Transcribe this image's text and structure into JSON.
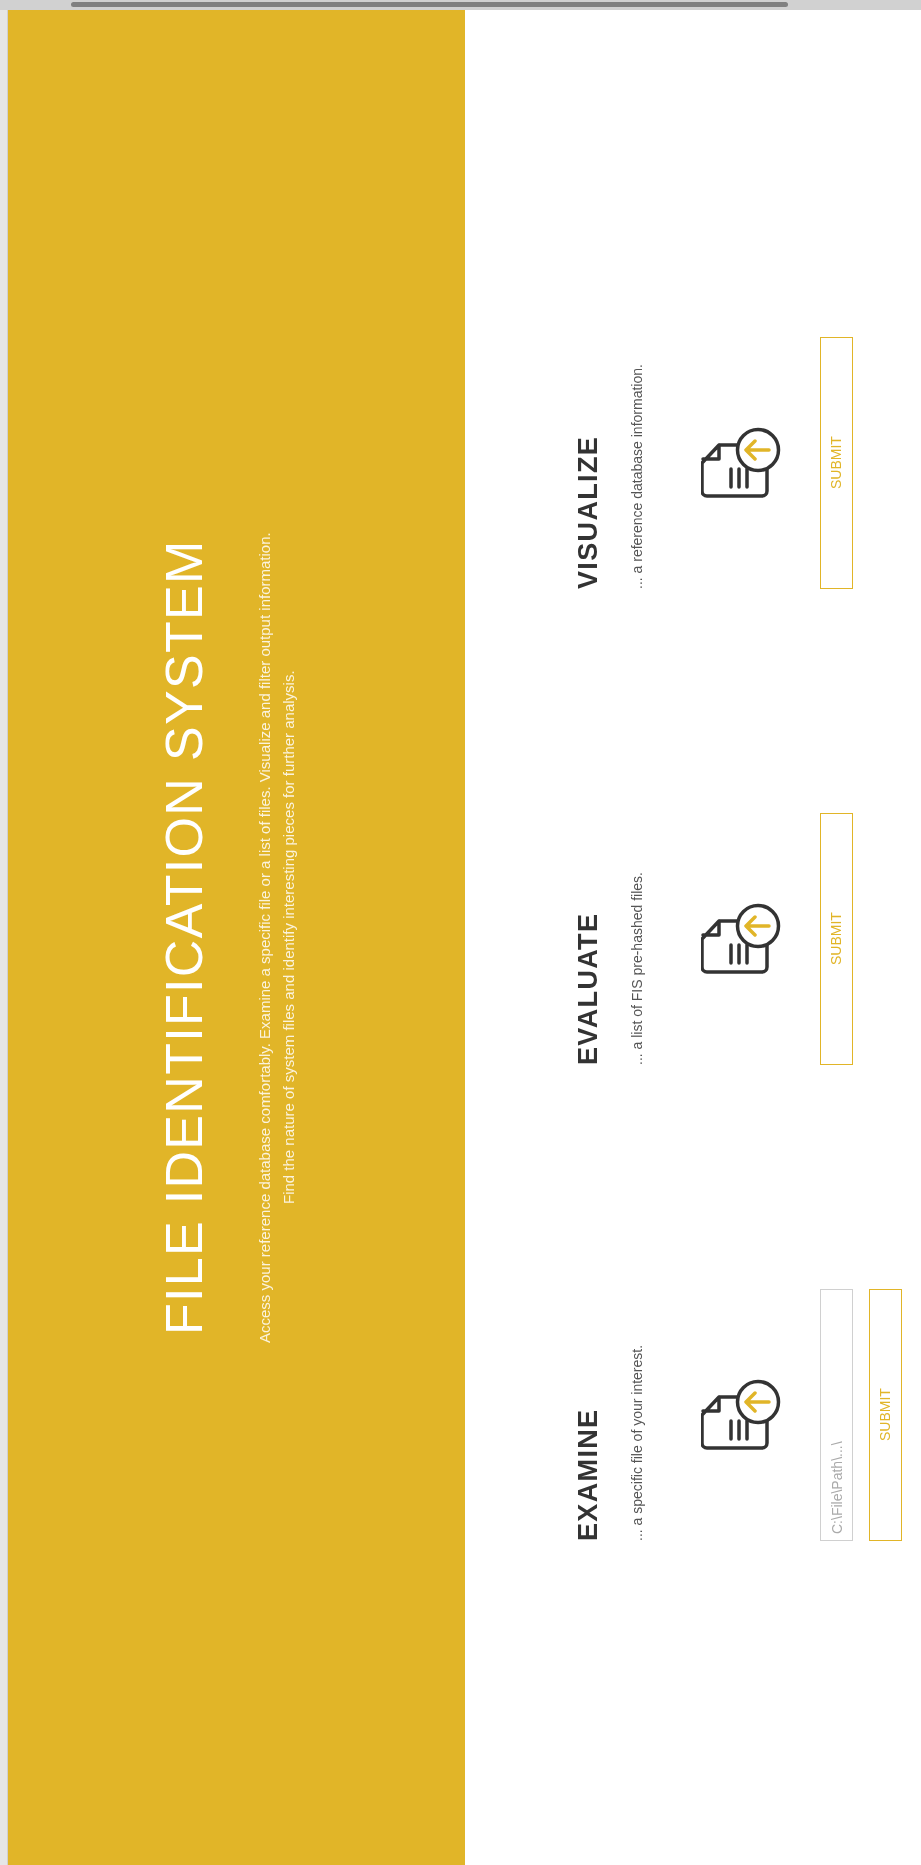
{
  "hero": {
    "title": "FILE IDENTIFICATION SYSTEM",
    "description": [
      "Access your reference database comfortably. Examine a specific file or a list of files. Visualize and filter output information.",
      "Find the nature of system files and identify interesting pieces for further analysis."
    ]
  },
  "sections": [
    {
      "title": "EXAMINE",
      "subtitle": "... a specific file of your interest.",
      "field": {
        "placeholder": "C:\\File\\Path\\...\\"
      },
      "button": "SUBMIT"
    },
    {
      "title": "EVALUATE",
      "subtitle": "... a list of FIS pre-hashed files.",
      "button": "SUBMIT"
    },
    {
      "title": "VISUALIZE",
      "subtitle": "... a reference database information.",
      "button": "SUBMIT"
    }
  ]
}
